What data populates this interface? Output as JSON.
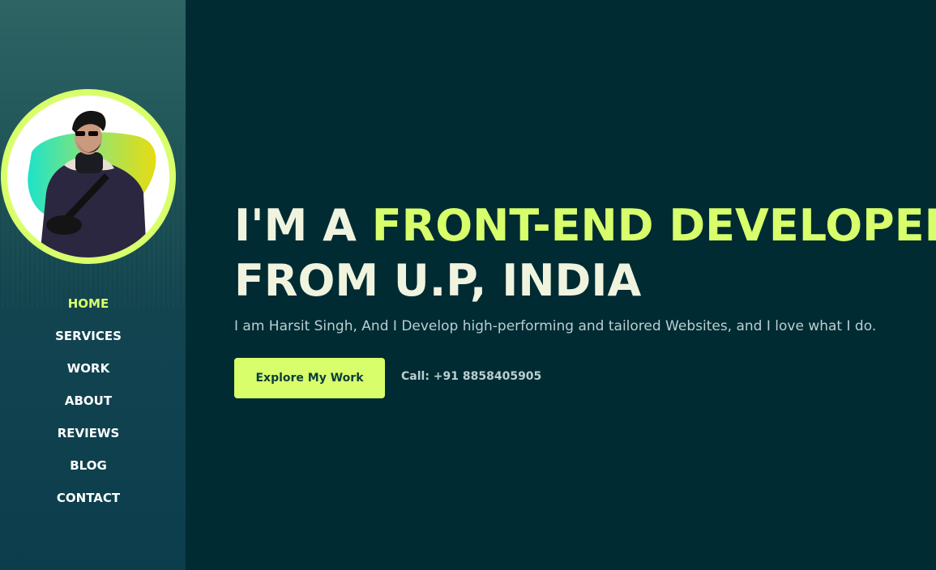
{
  "colors": {
    "accent": "#d8ff6b",
    "background": "#002b33",
    "headline": "#f0f4df",
    "muted": "#b9cfd0"
  },
  "sidebar": {
    "avatar_icon": "person-photo-icon",
    "nav": [
      {
        "label": "HOME",
        "active": true
      },
      {
        "label": "SERVICES",
        "active": false
      },
      {
        "label": "WORK",
        "active": false
      },
      {
        "label": "ABOUT",
        "active": false
      },
      {
        "label": "REVIEWS",
        "active": false
      },
      {
        "label": "BLOG",
        "active": false
      },
      {
        "label": "CONTACT",
        "active": false
      }
    ]
  },
  "hero": {
    "headline_prefix": "I'M A ",
    "headline_accent": "FRONT-END DEVELOPER",
    "headline_line2": "FROM U.P, INDIA",
    "subtitle": "I am Harsit Singh, And I Develop high-performing and tailored Websites, and I love what I do.",
    "cta_label": "Explore My Work",
    "call_text": "Call: +91 8858405905"
  }
}
